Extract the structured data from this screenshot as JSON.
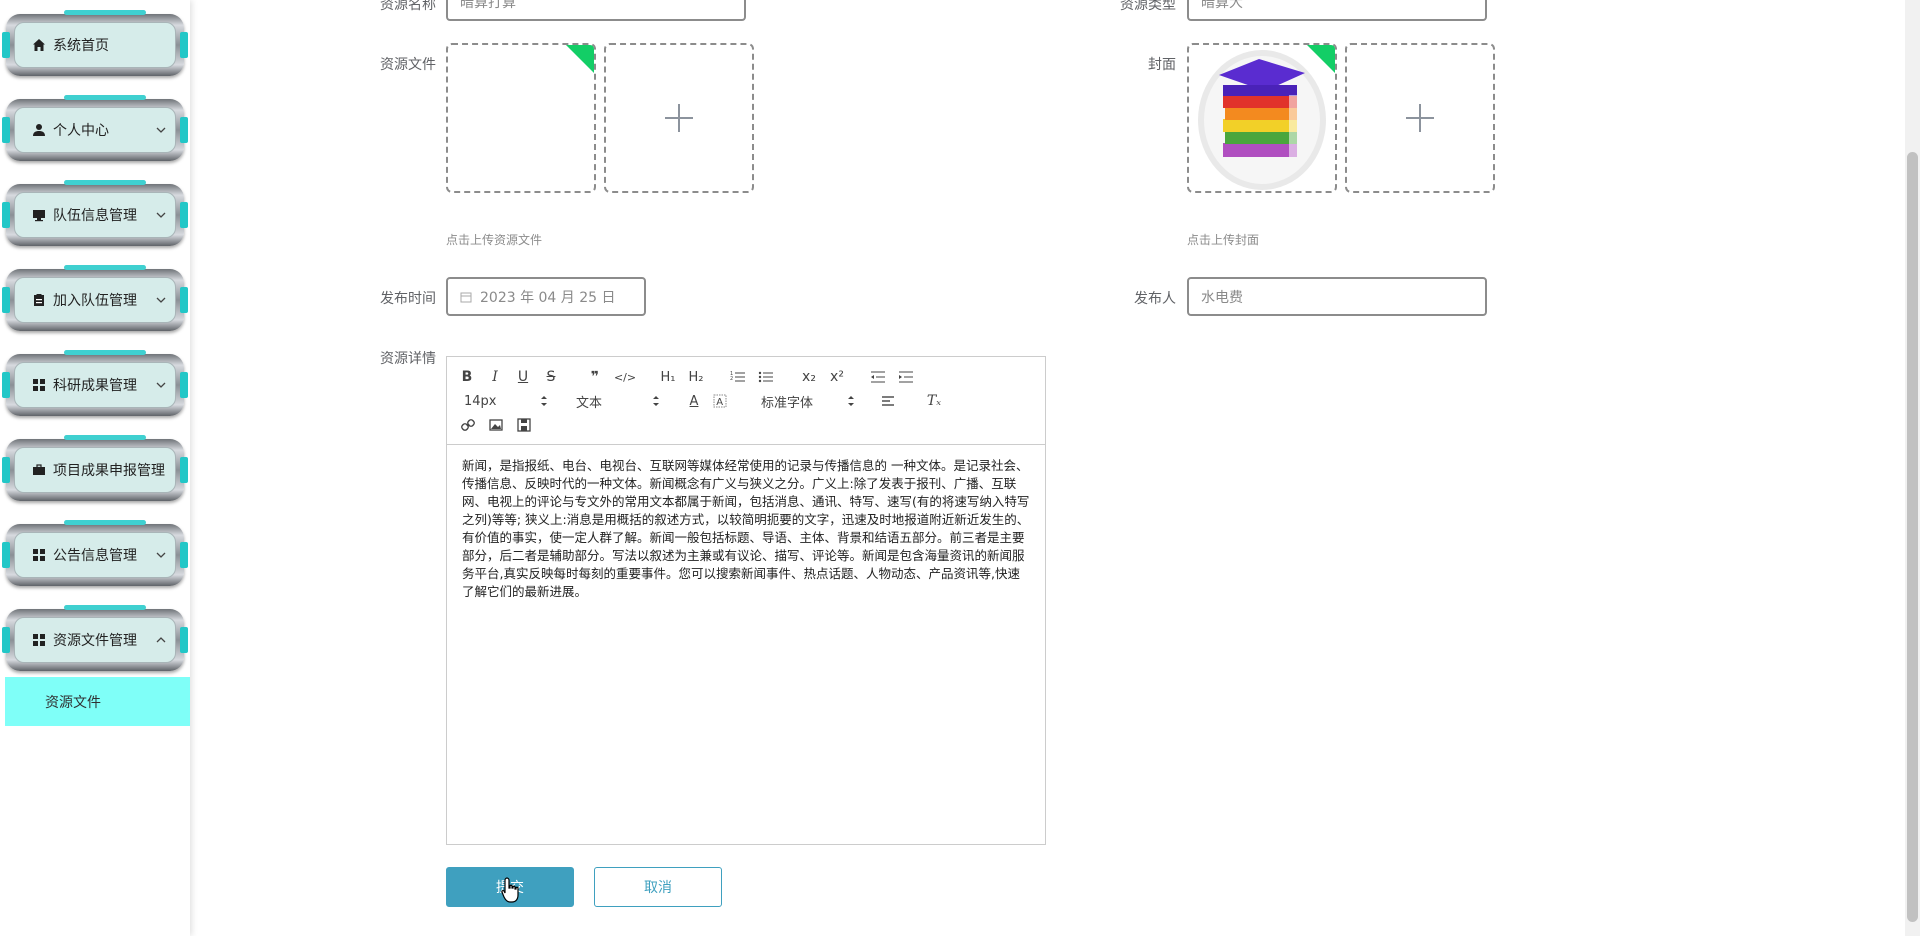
{
  "sidebar": {
    "items": [
      {
        "label": "系统首页",
        "icon": "home-icon"
      },
      {
        "label": "个人中心",
        "icon": "user-icon"
      },
      {
        "label": "队伍信息管理",
        "icon": "monitor-icon"
      },
      {
        "label": "加入队伍管理",
        "icon": "clipboard-icon"
      },
      {
        "label": "科研成果管理",
        "icon": "grid-icon"
      },
      {
        "label": "项目成果申报管理",
        "icon": "briefcase-icon"
      },
      {
        "label": "公告信息管理",
        "icon": "grid-icon"
      },
      {
        "label": "资源文件管理",
        "icon": "grid-icon"
      }
    ],
    "submenu_label": "资源文件"
  },
  "form": {
    "name_label": "资源名称",
    "name_value": "暗算打算",
    "type_label": "资源类型",
    "type_value": "暗算大",
    "file_label": "资源文件",
    "file_tip": "点击上传资源文件",
    "cover_label": "封面",
    "cover_tip": "点击上传封面",
    "time_label": "发布时间",
    "time_value": "2023 年 04 月 25 日",
    "publisher_label": "发布人",
    "publisher_value": "水电费",
    "detail_label": "资源详情"
  },
  "editor": {
    "font_size": "14px",
    "block_type": "文本",
    "font_family": "标准字体",
    "content": "新闻，是指报纸、电台、电视台、互联网等媒体经常使用的记录与传播信息的 一种文体。是记录社会、传播信息、反映时代的一种文体。新闻概念有广义与狭义之分。广义上:除了发表于报刊、广播、互联网、电视上的评论与专文外的常用文本都属于新闻，包括消息、通讯、特写、速写(有的将速写纳入特写之列)等等; 狭义上:消息是用概括的叙述方式，以较简明扼要的文字，迅速及时地报道附近新近发生的、有价值的事实，使一定人群了解。新闻一般包括标题、导语、主体、背景和结语五部分。前三者是主要部分，后二者是辅助部分。写法以叙述为主兼或有议论、描写、评论等。新闻是包含海量资讯的新闻服务平台,真实反映每时每刻的重要事件。您可以搜索新闻事件、热点话题、人物动态、产品资讯等,快速了解它们的最新进展。"
  },
  "buttons": {
    "submit": "提交",
    "cancel": "取消"
  },
  "colors": {
    "primary": "#3fa0bf",
    "submenu_bg": "#7ffff8",
    "menu_inner": "#d6ecea",
    "corner_badge": "#13ce66"
  }
}
